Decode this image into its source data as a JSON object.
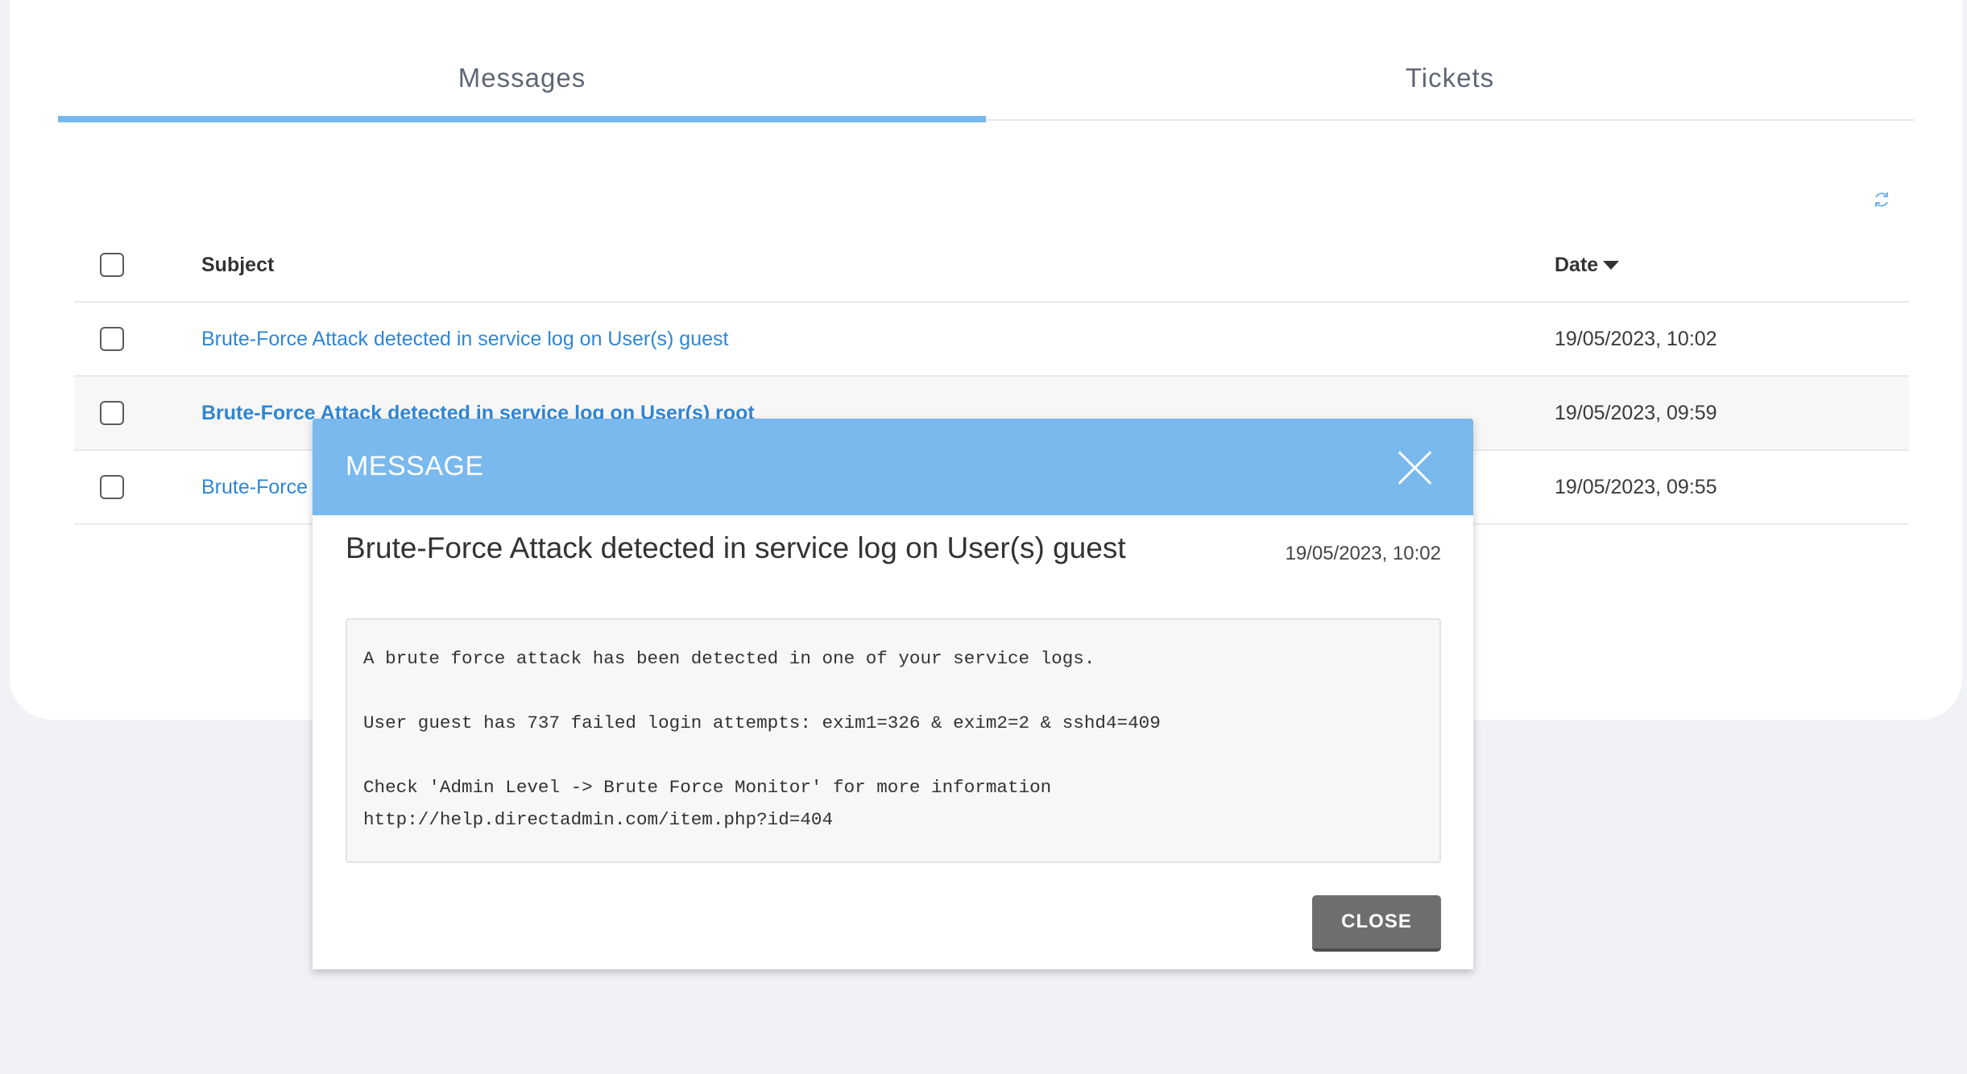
{
  "tabs": [
    {
      "label": "Messages",
      "active": true
    },
    {
      "label": "Tickets",
      "active": false
    }
  ],
  "table": {
    "columns": {
      "subject": "Subject",
      "date": "Date"
    },
    "rows": [
      {
        "subject": "Brute-Force Attack detected in service log on User(s) guest",
        "date": "19/05/2023, 10:02",
        "bold": false
      },
      {
        "subject": "Brute-Force Attack detected in service log on User(s) root",
        "date": "19/05/2023, 09:59",
        "bold": true
      },
      {
        "subject": "Brute-Force",
        "date": "19/05/2023, 09:55",
        "bold": false
      }
    ]
  },
  "modal": {
    "title": "MESSAGE",
    "subject": "Brute-Force Attack detected in service log on User(s) guest",
    "date": "19/05/2023, 10:02",
    "body": "A brute force attack has been detected in one of your service logs.\n\nUser guest has 737 failed login attempts: exim1=326 & exim2=2 & sshd4=409\n\nCheck 'Admin Level -> Brute Force Monitor' for more information\nhttp://help.directadmin.com/item.php?id=404",
    "close_label": "CLOSE"
  },
  "colors": {
    "accent": "#79b9ee",
    "link": "#2f86d4",
    "button": "#6e6e6e"
  },
  "icons": [
    "refresh-icon",
    "sort-desc-icon",
    "close-icon"
  ]
}
